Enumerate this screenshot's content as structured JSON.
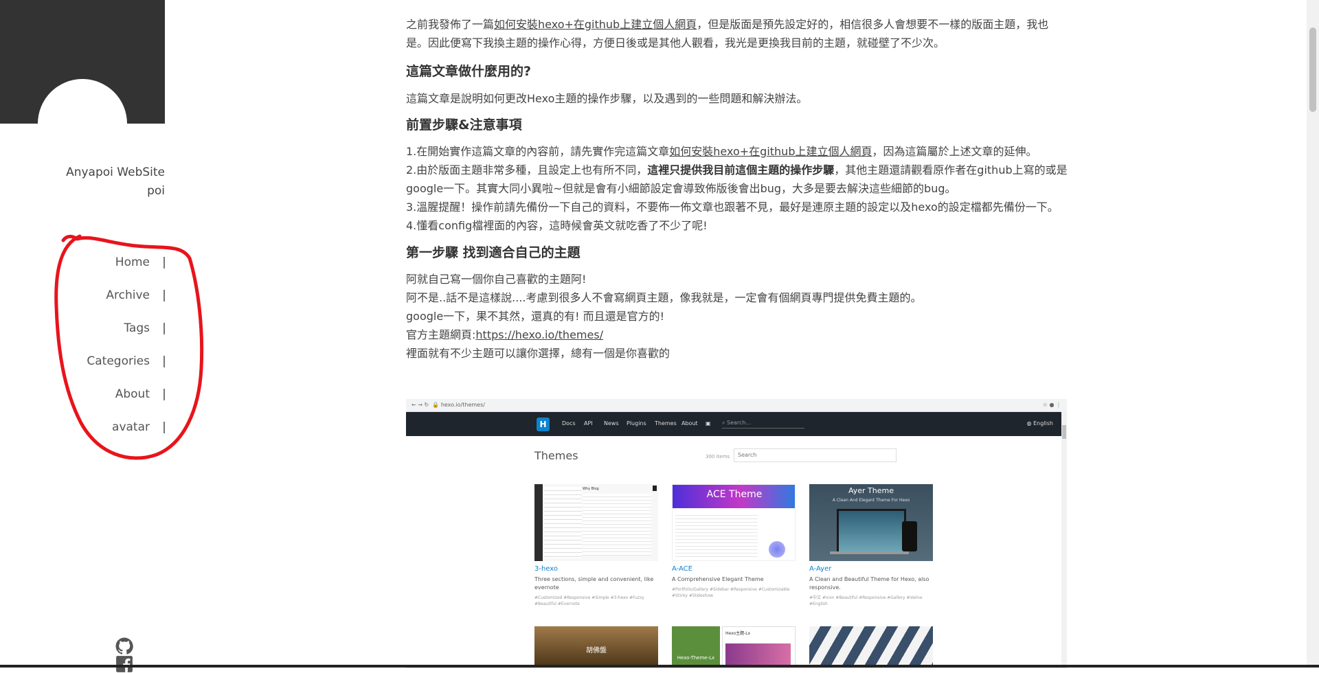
{
  "sidebar": {
    "site_name_line1": "Anyapoi WebSite",
    "site_name_line2": "poi",
    "nav": [
      {
        "label": "Home"
      },
      {
        "label": "Archive"
      },
      {
        "label": "Tags"
      },
      {
        "label": "Categories"
      },
      {
        "label": "About"
      },
      {
        "label": "avatar"
      }
    ],
    "social": [
      "github-icon",
      "facebook-icon"
    ]
  },
  "article": {
    "intro_pre": "之前我發佈了一篇",
    "intro_link": "如何安裝hexo+在github上建立個人網頁",
    "intro_post": "，但是版面是預先設定好的，相信很多人會想要不一樣的版面主題，我也是。因此便寫下我換主題的操作心得，方便日後或是其他人觀看，我光是更換我目前的主題，就碰壁了不少次。",
    "h_what": "這篇文章做什麼用的?",
    "p_what": "這篇文章是說明如何更改Hexo主題的操作步驟，以及遇到的一些問題和解決辦法。",
    "h_pre": "前置步驟&注意事項",
    "pre1_pre": "1.在開始實作這篇文章的內容前，請先實作完這篇文章",
    "pre1_link": "如何安裝hexo+在github上建立個人網頁",
    "pre1_post": "，因為這篇屬於上述文章的延伸。",
    "pre2_pre": "2.由於版面主題非常多種，且設定上也有所不同，",
    "pre2_bold": "這裡只提供我目前這個主題的操作步驟",
    "pre2_post": "，其他主題還請觀看原作者在github上寫的或是google一下。其實大同小異啦~但就是會有小細節設定會導致佈版後會出bug，大多是要去解決這些細節的bug。",
    "pre3": "3.溫腥提醒！操作前請先備份一下自己的資料，不要佈一佈文章也跟著不見，最好是連原主題的設定以及hexo的設定檔都先備份一下。",
    "pre4": "4.懂看config檔裡面的內容，這時候會英文就吃香了不少了呢!",
    "h_step1": "第一步驟 找到適合自己的主題",
    "s1": "阿就自己寫一個你自己喜歡的主題阿!",
    "s2": "阿不是..話不是這樣說....考慮到很多人不會寫網頁主題，像我就是，一定會有個網頁專門提供免費主題的。",
    "s3": "google一下，果不其然，還真的有! 而且還是官方的!",
    "s4_pre": "官方主題網頁:",
    "s4_link": "https://hexo.io/themes/",
    "s5": "裡面就有不少主題可以讓你選擇，總有一個是你喜歡的"
  },
  "screenshot": {
    "url": "hexo.io/themes/",
    "logo": "H",
    "nav": [
      "Docs",
      "API",
      "News",
      "Plugins",
      "Themes",
      "About"
    ],
    "search_placeholder": "Search...",
    "lang": "English",
    "title": "Themes",
    "count": "300 items",
    "filter_placeholder": "Search",
    "cards": [
      {
        "name": "3-hexo",
        "desc": "Three sections, simple and convenient, like evernote",
        "tags": "#Customized #Responsive #Simple #3-hexo #Fuzzy #Beautiful #Evernote",
        "thumb_title": "Why Blog"
      },
      {
        "name": "A-ACE",
        "desc": "A Comprehensive Elegant Theme",
        "tags": "#Portfolio/Gallery #Sidebar #Responsive #Customizable #Sticky #Slideshow",
        "thumb_title": "ACE Theme"
      },
      {
        "name": "A-Ayer",
        "desc": "A Clean and Beautiful Theme for Hexo, also responsive.",
        "tags": "#中文 #Icon #Beautiful #Responsive #Gallery #Valine #English",
        "thumb_title": "Ayer Theme",
        "thumb_sub": "A Clean And Elegant Theme For Hexo"
      }
    ],
    "row2": [
      "胡佛盤",
      "Hexo-Theme-Lx",
      "Hexo主題-Lx"
    ]
  }
}
